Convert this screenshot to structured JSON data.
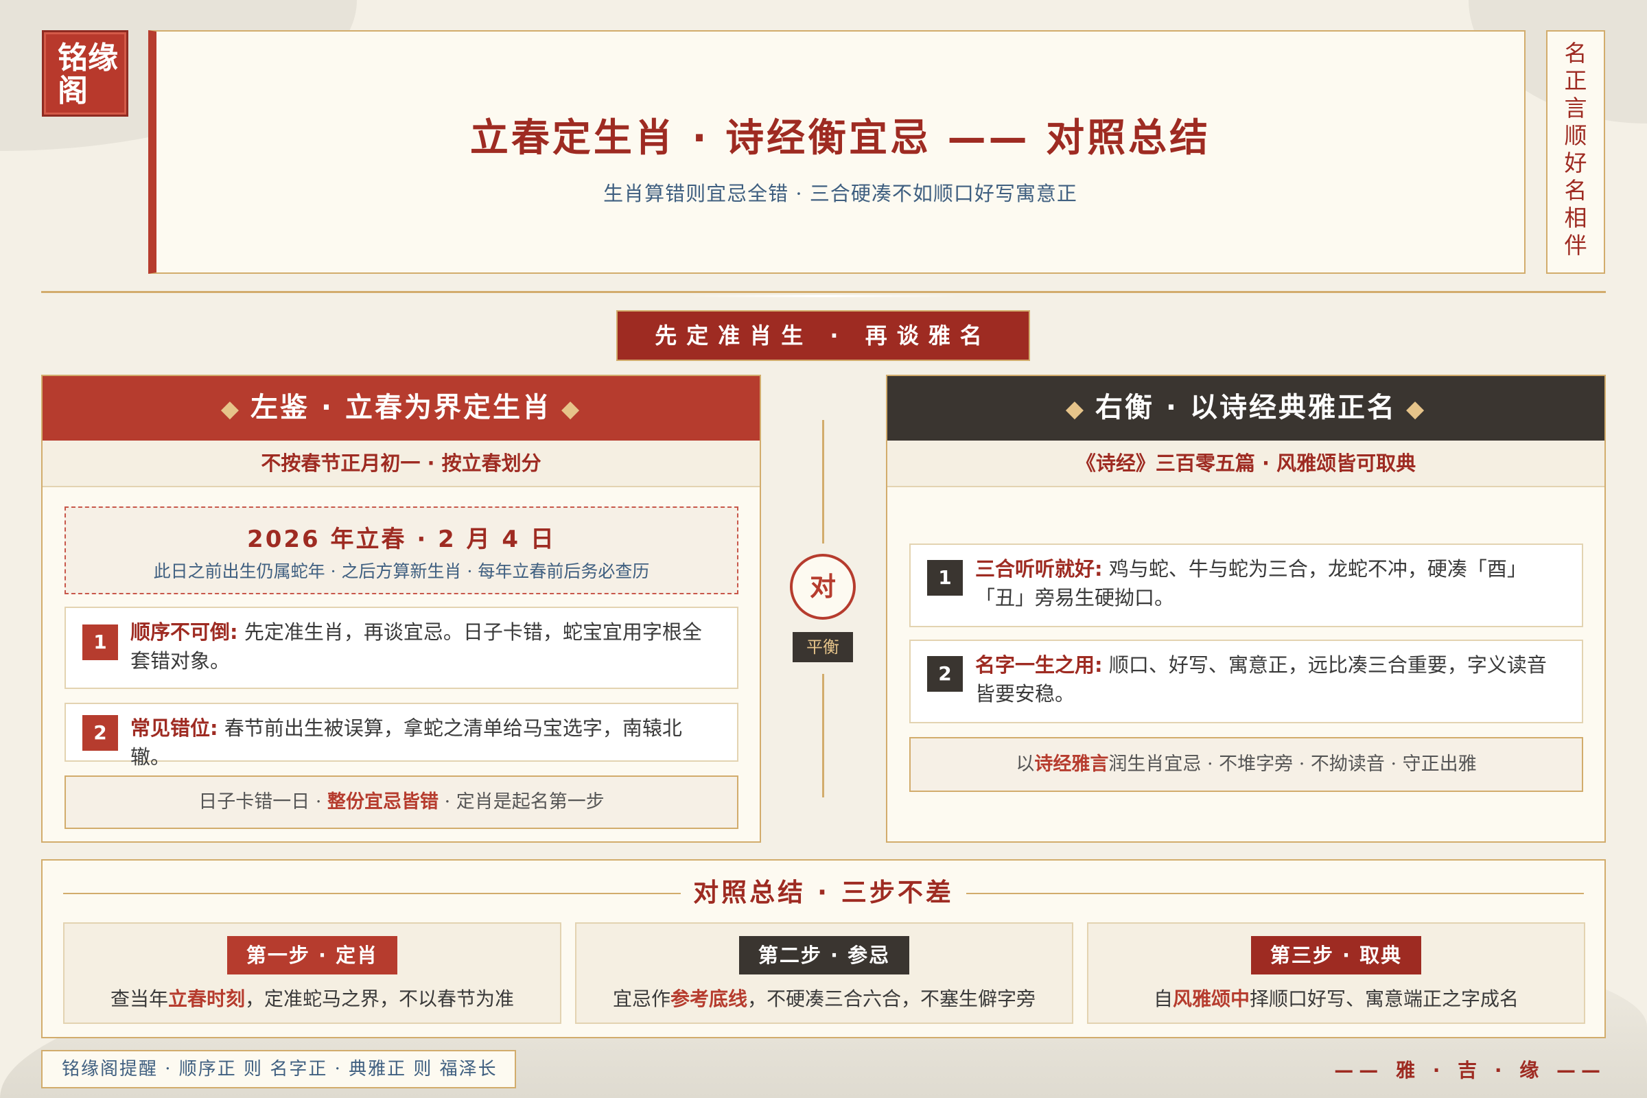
{
  "seal": "铭缘阁",
  "header": {
    "title": "立春定生肖 · 诗经衡宜忌 —— 对照总结",
    "subtitle": "生肖算错则宜忌全错 · 三合硬凑不如顺口好写寓意正"
  },
  "vertical_motto": [
    "名",
    "正",
    "言",
    "顺",
    "好",
    "名",
    "相",
    "伴"
  ],
  "banner": "先定准肖生 · 再谈雅名",
  "left_panel": {
    "heading": "左鉴 · 立春为界定生肖",
    "subheading": "不按春节正月初一 · 按立春划分",
    "date_title": "2026 年立春 · 2 月 4 日",
    "date_note": "此日之前出生仍属蛇年 · 之后方算新生肖 · 每年立春前后务必查历",
    "cards": [
      {
        "num": "1",
        "key": "顺序不可倒:",
        "text": "先定准生肖，再谈宜忌。日子卡错，蛇宝宜用字根全套错对象。"
      },
      {
        "num": "2",
        "key": "常见错位:",
        "text": "春节前出生被误算，拿蛇之清单给马宝选字，南辕北辙。"
      }
    ],
    "footer": {
      "pre": "日子卡错一日 · ",
      "hl": "整份宜忌皆错",
      "post": " · 定肖是起名第一步"
    }
  },
  "center": {
    "circle": "对",
    "tag": "平衡"
  },
  "right_panel": {
    "heading": "右衡 · 以诗经典雅正名",
    "subheading": "《诗经》三百零五篇 · 风雅颂皆可取典",
    "cards": [
      {
        "num": "1",
        "key": "三合听听就好:",
        "text": "鸡与蛇、牛与蛇为三合，龙蛇不冲，硬凑「酉」「丑」旁易生硬拗口。"
      },
      {
        "num": "2",
        "key": "名字一生之用:",
        "text": "顺口、好写、寓意正，远比凑三合重要，字义读音皆要安稳。"
      }
    ],
    "footer": {
      "pre": "以",
      "hl": "诗经雅言",
      "post": "润生肖宜忌 · 不堆字旁 · 不拗读音 · 守正出雅"
    }
  },
  "summary": {
    "title": "对照总结 · 三步不差",
    "steps": [
      {
        "tag": "第一步 · 定肖",
        "pre": "查当年",
        "hl": "立春时刻",
        "post": "，定准蛇马之界，不以春节为准",
        "color": "#b63c2e"
      },
      {
        "tag": "第二步 · 参忌",
        "pre": "宜忌作",
        "hl": "参考底线",
        "post": "，不硬凑三合六合，不塞生僻字旁",
        "color": "#3a3530"
      },
      {
        "tag": "第三步 · 取典",
        "pre": "自",
        "hl": "风雅颂中",
        "post": "择顺口好写、寓意端正之字成名",
        "color": "#9e2b22"
      }
    ]
  },
  "footer_note": "铭缘阁提醒 · 顺序正 则 名字正 · 典雅正 则 福泽长",
  "footer_right": "—— 雅 · 吉 · 缘 ——"
}
